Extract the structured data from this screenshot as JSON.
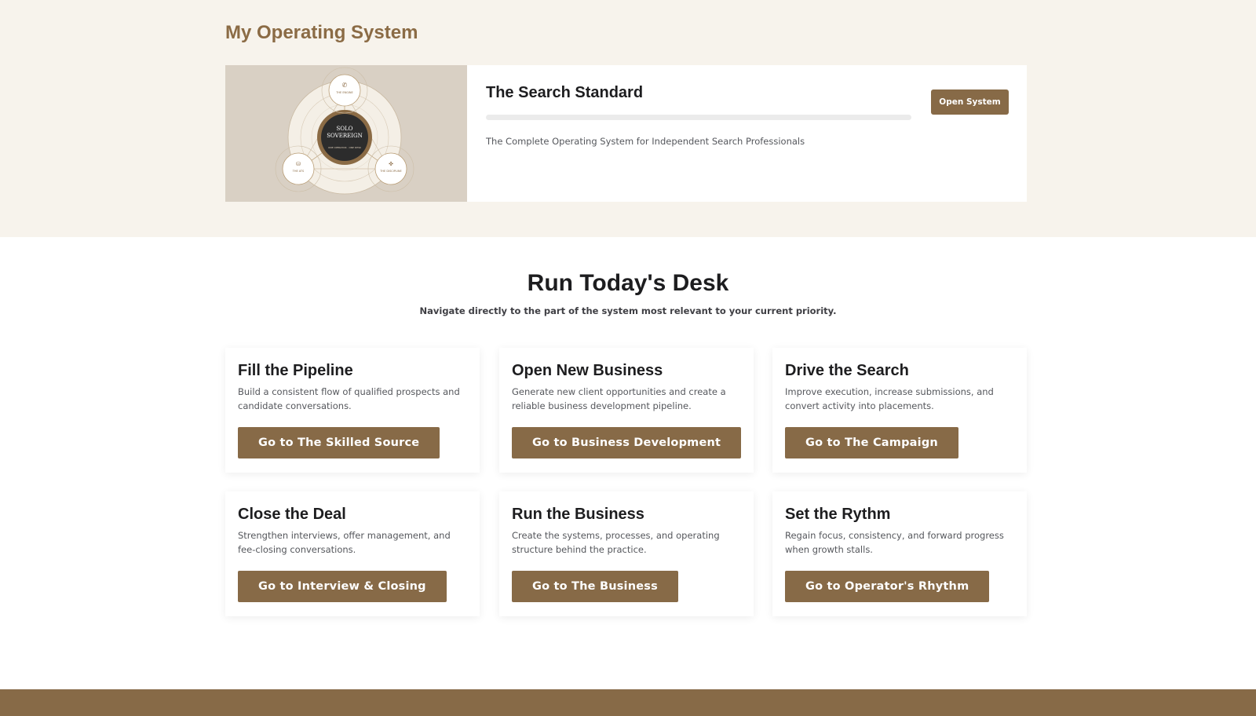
{
  "my_os": {
    "title": "My Operating System",
    "system": {
      "name": "The Search Standard",
      "description": "The Complete Operating System for Independent Search Professionals",
      "button_label": "Open System",
      "progress": 0,
      "thumbnail": {
        "center_line1": "SOLO",
        "center_line2": "SOVEREIGN",
        "center_sub": "ONE OPERATOR · ONE DESK",
        "node_top": "THE ENGINE",
        "node_left": "THE ATS",
        "node_right": "THE DISCIPLINE"
      }
    }
  },
  "desk": {
    "title": "Run Today's Desk",
    "subtitle": "Navigate directly to the part of the system most relevant to your current priority.",
    "cards": [
      {
        "title": "Fill the Pipeline",
        "description": "Build a consistent flow of qualified prospects and candidate conversations.",
        "button_label": "Go to The Skilled Source"
      },
      {
        "title": "Open New Business",
        "description": "Generate new client opportunities and create a reliable business development pipeline.",
        "button_label": "Go to Business Development"
      },
      {
        "title": "Drive the Search",
        "description": "Improve execution, increase submissions, and convert activity into placements.",
        "button_label": "Go to The Campaign"
      },
      {
        "title": "Close the Deal",
        "description": "Strengthen interviews, offer management, and fee-closing conversations.",
        "button_label": "Go to Interview & Closing"
      },
      {
        "title": "Run the Business",
        "description": "Create the systems, processes, and operating structure behind the practice.",
        "button_label": "Go to The Business"
      },
      {
        "title": "Set the Rythm",
        "description": "Regain focus, consistency, and forward progress when growth stalls.",
        "button_label": "Go to Operator's Rhythm"
      }
    ]
  },
  "colors": {
    "accent": "#876a47",
    "accent_text": "#8b6b45",
    "top_background": "#f7f3ec",
    "thumbnail_background": "#d9d0c4"
  }
}
